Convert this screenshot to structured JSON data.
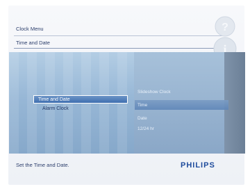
{
  "header": {
    "title": "Clock Menu",
    "subtitle": "Time and Date"
  },
  "menu": {
    "items": [
      {
        "label": "Time and Date",
        "selected": true
      },
      {
        "label": "Alarm Clock",
        "selected": false
      }
    ]
  },
  "submenu": {
    "items": [
      {
        "label": "Slideshow Clock"
      },
      {
        "label": "Time",
        "highlighted": true
      },
      {
        "label": "Date"
      },
      {
        "label": "12/24 hr"
      }
    ]
  },
  "footer": {
    "help_text": "Set the Time and Date."
  },
  "brand": {
    "logo": "PHILIPS",
    "color": "#1e4b9c"
  },
  "icons": {
    "help": "info-help-icon"
  }
}
